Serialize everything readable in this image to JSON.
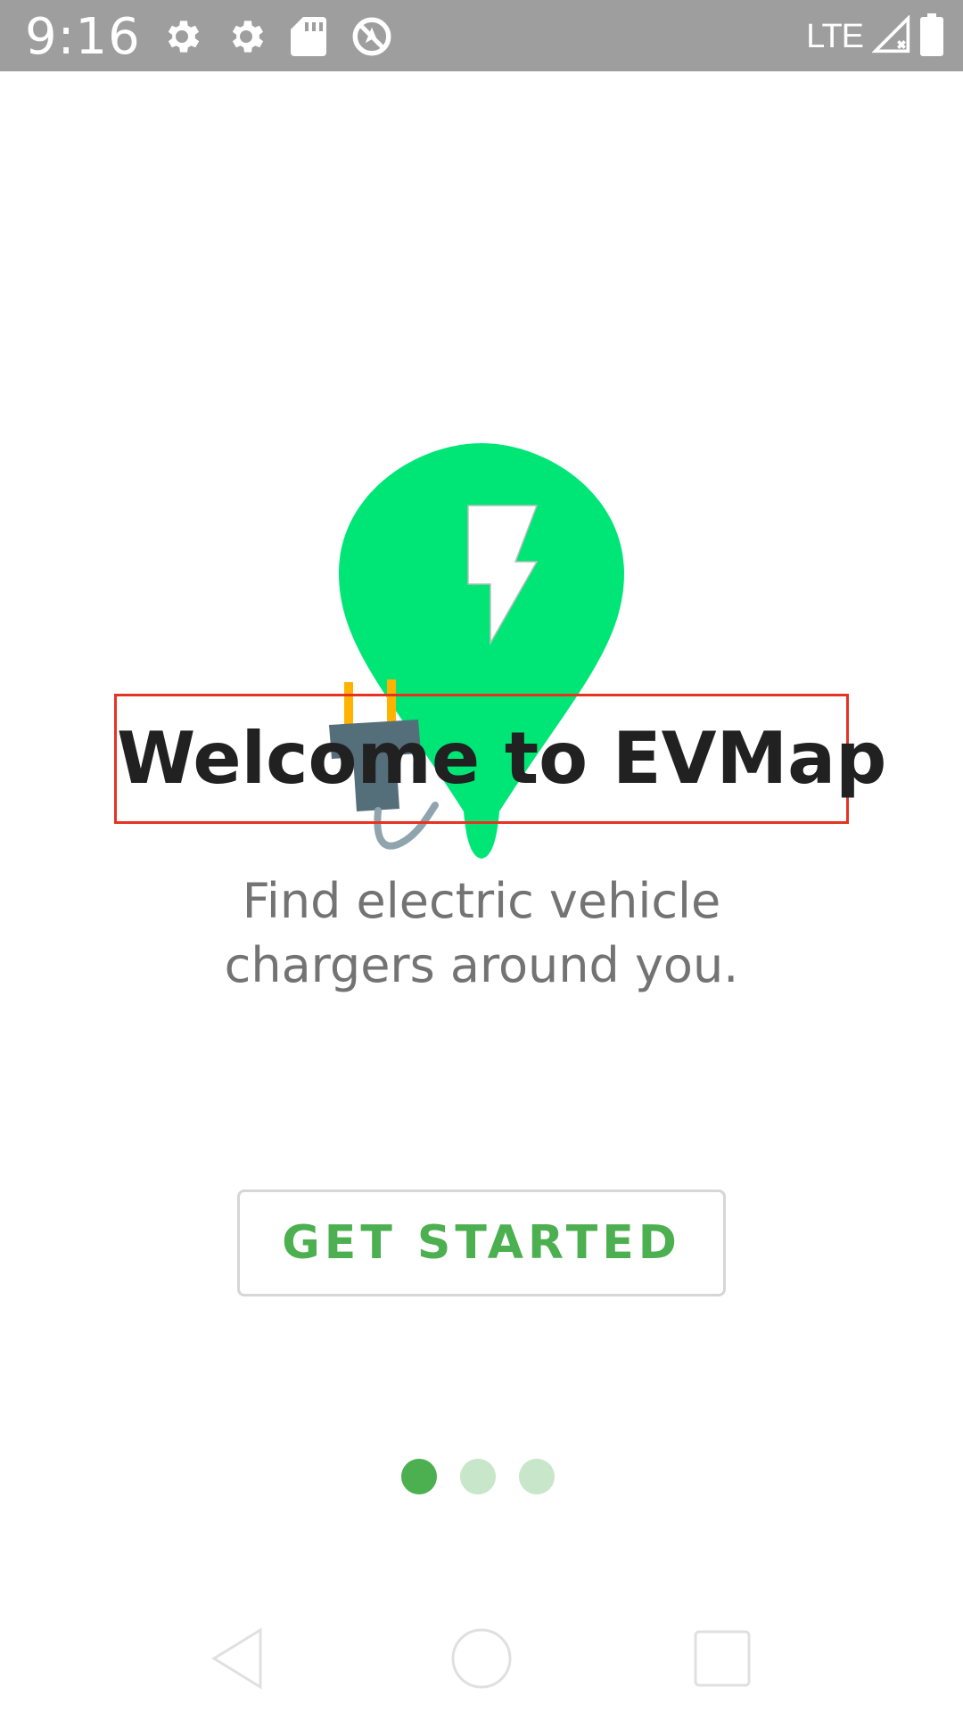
{
  "status_bar": {
    "time": "9:16",
    "network": "LTE",
    "icons": [
      "settings-icon",
      "settings-icon",
      "sd-card-icon",
      "location-off-icon",
      "signal-no-data-icon",
      "battery-full-icon"
    ]
  },
  "onboarding": {
    "title": "Welcome to EVMap",
    "subtitle": "Find electric vehicle\nchargers around you.",
    "button_label": "GET STARTED",
    "current_page": 1,
    "page_count": 3,
    "colors": {
      "accent": "#4caf50",
      "accent_light": "#c8e6c9",
      "pin_green": "#00e676",
      "highlight_border": "#e53322"
    }
  },
  "nav_bar": {
    "items": [
      "back-icon",
      "home-icon",
      "recents-icon"
    ]
  }
}
